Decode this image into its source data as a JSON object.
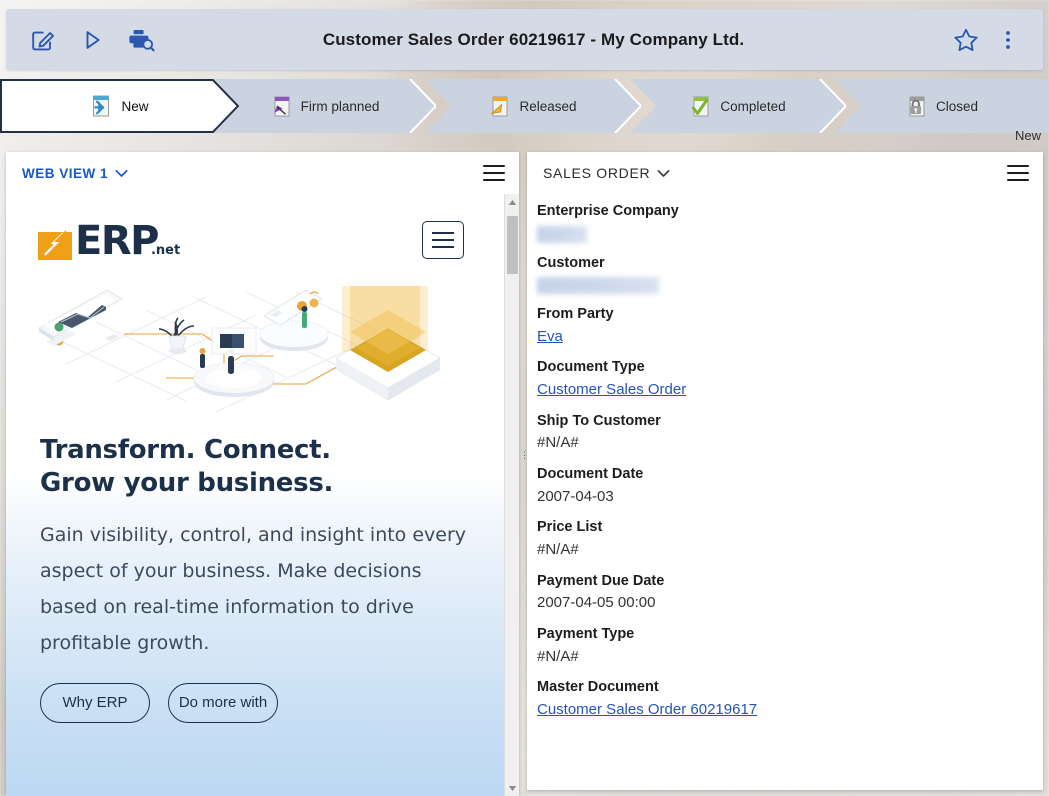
{
  "window": {
    "title": "Customer Sales Order 60219617 - My Company Ltd."
  },
  "toolbar": {
    "edit_icon": "edit-pencil-icon",
    "execute_icon": "play-icon",
    "print_preview_icon": "print-preview-icon",
    "favorite_icon": "star-icon",
    "more_icon": "more-vertical-icon"
  },
  "workflow": {
    "caption": "New",
    "states": [
      {
        "label": "New",
        "icon": "document-new-icon",
        "active": true
      },
      {
        "label": "Firm planned",
        "icon": "document-firmplanned-icon",
        "active": false
      },
      {
        "label": "Released",
        "icon": "document-released-icon",
        "active": false
      },
      {
        "label": "Completed",
        "icon": "document-completed-icon",
        "active": false
      },
      {
        "label": "Closed",
        "icon": "document-closed-icon",
        "active": false
      }
    ]
  },
  "left_panel": {
    "title": "WEB VIEW 1",
    "caret_icon": "chevron-down-icon",
    "menu_icon": "hamburger-menu-icon",
    "scroll": {
      "up_icon": "scroll-up-arrow-icon",
      "down_icon": "scroll-down-arrow-icon"
    },
    "web_view": {
      "logo_word": "ERP",
      "logo_tld": ".net",
      "logo_mark_icon": "erp-arrow-logo-icon",
      "nav_toggle_icon": "hamburger-menu-icon",
      "illustration_icon": "isometric-business-platform-illustration",
      "headline": "Transform. Connect.\nGrow your business.",
      "subtext": "Gain visibility, control, and insight into every aspect of your business. Make decisions based on real-time information to drive profitable growth.",
      "buttons": [
        {
          "label": "Why ERP"
        },
        {
          "label": "Do more with"
        }
      ]
    }
  },
  "right_panel": {
    "title": "SALES ORDER",
    "caret_icon": "chevron-down-icon",
    "menu_icon": "hamburger-menu-icon",
    "fields": [
      {
        "label": "Enterprise Company",
        "value": "",
        "kind": "redacted",
        "width": 50
      },
      {
        "label": "Customer",
        "value": "",
        "kind": "redacted",
        "width": 122
      },
      {
        "label": "From Party",
        "value": "Eva",
        "kind": "link"
      },
      {
        "label": "Document Type",
        "value": "Customer Sales Order",
        "kind": "link"
      },
      {
        "label": "Ship To Customer",
        "value": "#N/A#",
        "kind": "text"
      },
      {
        "label": "Document Date",
        "value": "2007-04-03",
        "kind": "text"
      },
      {
        "label": "Price List",
        "value": "#N/A#",
        "kind": "text"
      },
      {
        "label": "Payment Due Date",
        "value": "2007-04-05 00:00",
        "kind": "text"
      },
      {
        "label": "Payment Type",
        "value": "#N/A#",
        "kind": "text"
      },
      {
        "label": "Master Document",
        "value": "Customer Sales Order 60219617",
        "kind": "link"
      }
    ]
  },
  "colors": {
    "accent_blue": "#2254b8",
    "command_bar": "#d5dbe6",
    "chevron_fill": "#ccd3e0",
    "logo_orange": "#efa016",
    "logo_navy": "#1c3149"
  }
}
